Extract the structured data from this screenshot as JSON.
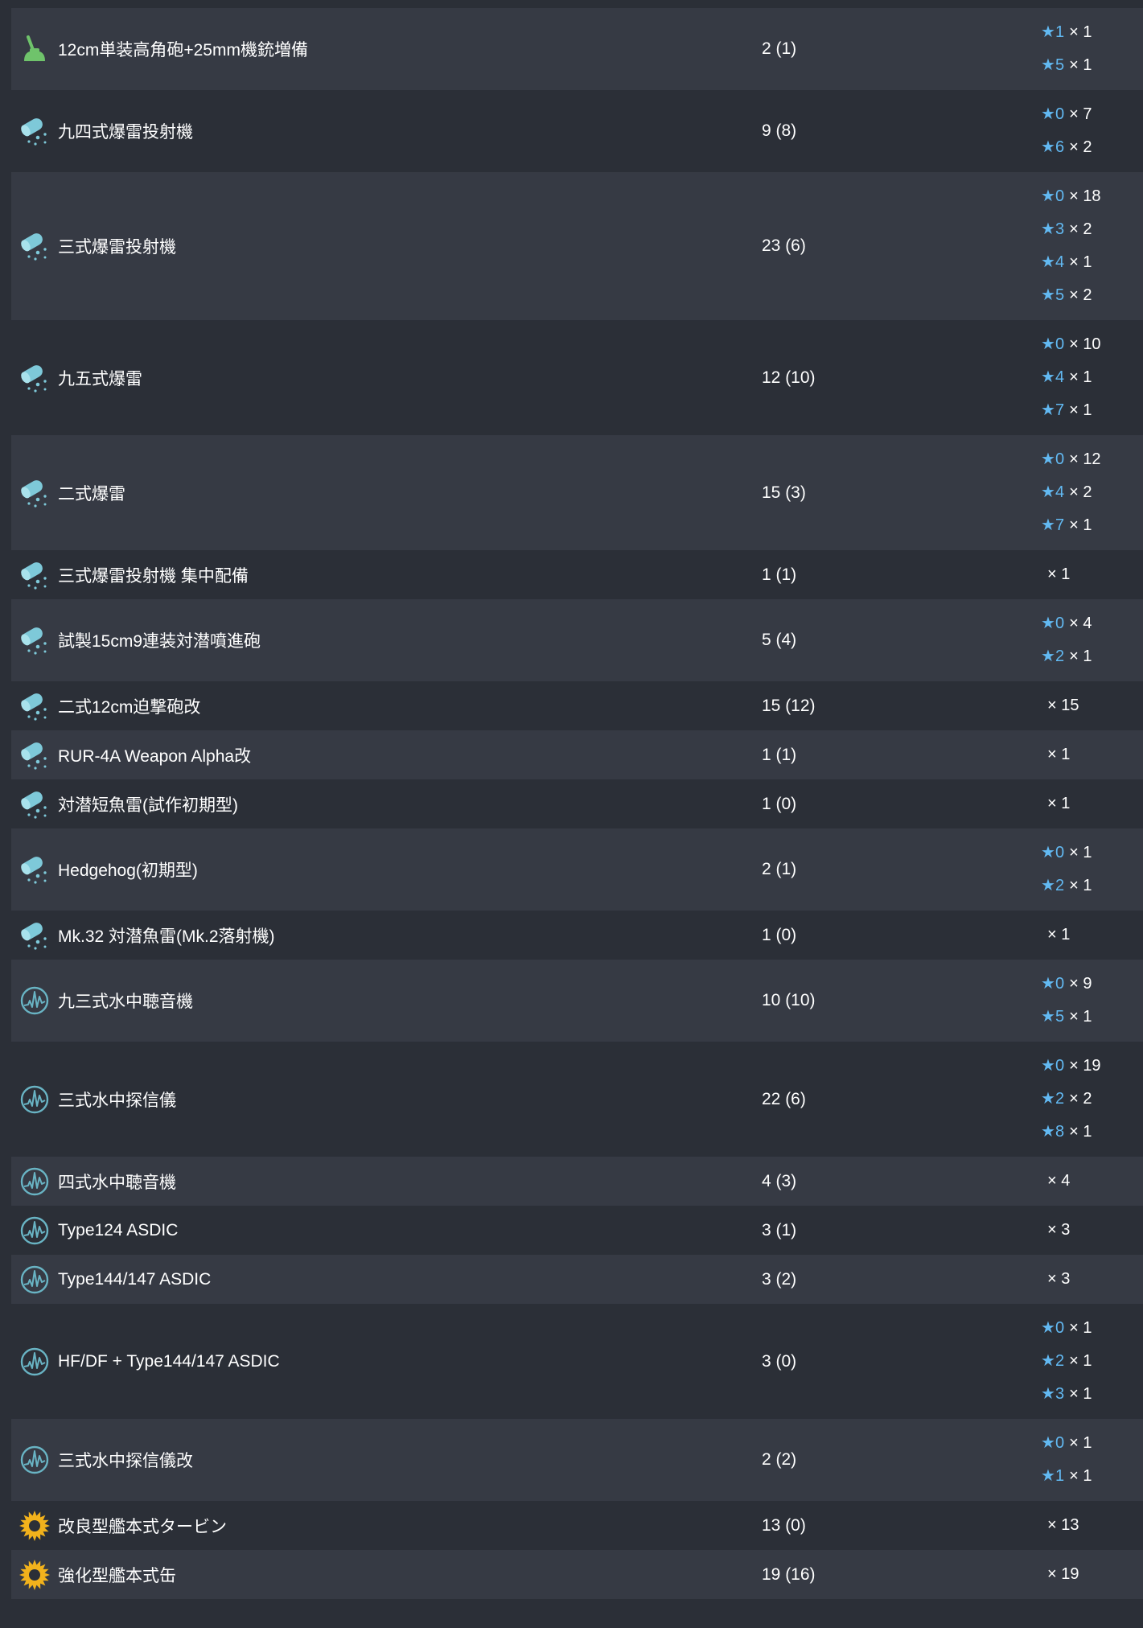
{
  "colors": {
    "background": "#2b2f37",
    "row_alt": "#363a44",
    "star": "#62b9f2",
    "text": "#ffffff",
    "gun_icon": "#6fc36b",
    "asw_icon": "#7ec9d9",
    "sonar_icon": "#69b4c4",
    "engine_icon": "#f2b21c"
  },
  "star_symbol": "★",
  "items": [
    {
      "icon": "gun-icon",
      "name": "12cm単装高角砲+25mm機銃増備",
      "count": "2 (1)",
      "levels": [
        {
          "star": "1",
          "count": "1"
        },
        {
          "star": "5",
          "count": "1"
        }
      ]
    },
    {
      "icon": "depth-charge-icon",
      "name": "九四式爆雷投射機",
      "count": "9 (8)",
      "levels": [
        {
          "star": "0",
          "count": "7"
        },
        {
          "star": "6",
          "count": "2"
        }
      ]
    },
    {
      "icon": "depth-charge-icon",
      "name": "三式爆雷投射機",
      "count": "23 (6)",
      "levels": [
        {
          "star": "0",
          "count": "18"
        },
        {
          "star": "3",
          "count": "2"
        },
        {
          "star": "4",
          "count": "1"
        },
        {
          "star": "5",
          "count": "2"
        }
      ]
    },
    {
      "icon": "depth-charge-icon",
      "name": "九五式爆雷",
      "count": "12 (10)",
      "levels": [
        {
          "star": "0",
          "count": "10"
        },
        {
          "star": "4",
          "count": "1"
        },
        {
          "star": "7",
          "count": "1"
        }
      ]
    },
    {
      "icon": "depth-charge-icon",
      "name": "二式爆雷",
      "count": "15 (3)",
      "levels": [
        {
          "star": "0",
          "count": "12"
        },
        {
          "star": "4",
          "count": "2"
        },
        {
          "star": "7",
          "count": "1"
        }
      ]
    },
    {
      "icon": "depth-charge-icon",
      "name": "三式爆雷投射機 集中配備",
      "count": "1 (1)",
      "levels": [
        {
          "star": null,
          "count": "1"
        }
      ]
    },
    {
      "icon": "depth-charge-icon",
      "name": "試製15cm9連装対潜噴進砲",
      "count": "5 (4)",
      "levels": [
        {
          "star": "0",
          "count": "4"
        },
        {
          "star": "2",
          "count": "1"
        }
      ]
    },
    {
      "icon": "depth-charge-icon",
      "name": "二式12cm迫撃砲改",
      "count": "15 (12)",
      "levels": [
        {
          "star": null,
          "count": "15"
        }
      ]
    },
    {
      "icon": "depth-charge-icon",
      "name": "RUR-4A Weapon Alpha改",
      "count": "1 (1)",
      "levels": [
        {
          "star": null,
          "count": "1"
        }
      ]
    },
    {
      "icon": "depth-charge-icon",
      "name": "対潜短魚雷(試作初期型)",
      "count": "1 (0)",
      "levels": [
        {
          "star": null,
          "count": "1"
        }
      ]
    },
    {
      "icon": "depth-charge-icon",
      "name": "Hedgehog(初期型)",
      "count": "2 (1)",
      "levels": [
        {
          "star": "0",
          "count": "1"
        },
        {
          "star": "2",
          "count": "1"
        }
      ]
    },
    {
      "icon": "depth-charge-icon",
      "name": "Mk.32 対潜魚雷(Mk.2落射機)",
      "count": "1 (0)",
      "levels": [
        {
          "star": null,
          "count": "1"
        }
      ]
    },
    {
      "icon": "sonar-icon",
      "name": "九三式水中聴音機",
      "count": "10 (10)",
      "levels": [
        {
          "star": "0",
          "count": "9"
        },
        {
          "star": "5",
          "count": "1"
        }
      ]
    },
    {
      "icon": "sonar-icon",
      "name": "三式水中探信儀",
      "count": "22 (6)",
      "levels": [
        {
          "star": "0",
          "count": "19"
        },
        {
          "star": "2",
          "count": "2"
        },
        {
          "star": "8",
          "count": "1"
        }
      ]
    },
    {
      "icon": "sonar-icon",
      "name": "四式水中聴音機",
      "count": "4 (3)",
      "levels": [
        {
          "star": null,
          "count": "4"
        }
      ]
    },
    {
      "icon": "sonar-icon",
      "name": "Type124 ASDIC",
      "count": "3 (1)",
      "levels": [
        {
          "star": null,
          "count": "3"
        }
      ]
    },
    {
      "icon": "sonar-icon",
      "name": "Type144/147 ASDIC",
      "count": "3 (2)",
      "levels": [
        {
          "star": null,
          "count": "3"
        }
      ]
    },
    {
      "icon": "sonar-icon",
      "name": "HF/DF + Type144/147 ASDIC",
      "count": "3 (0)",
      "levels": [
        {
          "star": "0",
          "count": "1"
        },
        {
          "star": "2",
          "count": "1"
        },
        {
          "star": "3",
          "count": "1"
        }
      ]
    },
    {
      "icon": "sonar-icon",
      "name": "三式水中探信儀改",
      "count": "2 (2)",
      "levels": [
        {
          "star": "0",
          "count": "1"
        },
        {
          "star": "1",
          "count": "1"
        }
      ]
    },
    {
      "icon": "engine-icon",
      "name": "改良型艦本式タービン",
      "count": "13 (0)",
      "levels": [
        {
          "star": null,
          "count": "13"
        }
      ]
    },
    {
      "icon": "engine-icon",
      "name": "強化型艦本式缶",
      "count": "19 (16)",
      "levels": [
        {
          "star": null,
          "count": "19"
        }
      ]
    }
  ]
}
